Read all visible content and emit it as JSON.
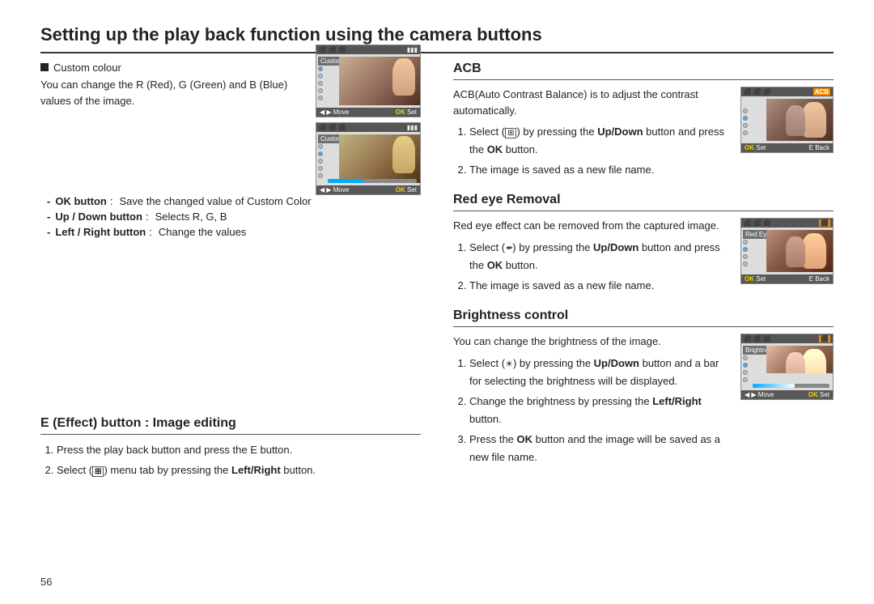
{
  "page": {
    "title": "Setting up the play back function using the camera buttons",
    "number": "56"
  },
  "left_col": {
    "custom_colour": {
      "heading": "Custom colour",
      "description": "You can change the R (Red), G (Green) and B (Blue) values of the image.",
      "details": [
        {
          "label": "OK button",
          "colon": ":",
          "value": "Save the changed value of Custom Color"
        },
        {
          "label": "Up / Down button",
          "colon": ":",
          "value": "Selects R, G, B"
        },
        {
          "label": "Left / Right button",
          "colon": ":",
          "value": "Change the values"
        }
      ],
      "screen1_label": "Custom Color",
      "screen1_bottom_left": "Move",
      "screen1_bottom_right": "Set",
      "screen2_label": "Custom Color",
      "screen2_bottom_left": "Move",
      "screen2_bottom_right": "Set"
    },
    "e_effect": {
      "heading": "E (Effect) button : Image editing",
      "steps": [
        "Press the play back button and press the E button.",
        "Select (      ) menu tab by pressing the Left/Right button."
      ],
      "step2_select": "Select",
      "step2_suffix": "menu tab by pressing the"
    }
  },
  "right_col": {
    "acb": {
      "heading": "ACB",
      "description": "ACB(Auto Contrast Balance) is to adjust the contrast automatically.",
      "steps": [
        {
          "text": "Select (",
          "icon": "grid-icon",
          "text2": ") by pressing the",
          "bold": "Up/Down",
          "text3": "button and press the",
          "bold2": "OK",
          "text4": "button."
        },
        {
          "text": "The image is saved as a new file name."
        }
      ],
      "screen_label": "ACB",
      "screen_bottom_left": "Set",
      "screen_bottom_ok": "OK",
      "screen_bottom_e": "E",
      "screen_bottom_back": "Back"
    },
    "red_eye": {
      "heading": "Red eye Removal",
      "description": "Red eye effect can be removed from the captured image.",
      "steps": [
        {
          "text": "Select (",
          "icon": "redeye-icon",
          "text2": ") by pressing the",
          "bold": "Up/Down",
          "text3": "button and press the",
          "bold2": "OK",
          "text4": "button."
        },
        {
          "text": "The image is saved as a new file name."
        }
      ],
      "screen_label": "Red Eye Fix",
      "screen_bottom_left": "Set",
      "screen_bottom_ok": "OK",
      "screen_bottom_e": "E",
      "screen_bottom_back": "Back"
    },
    "brightness": {
      "heading": "Brightness control",
      "description": "You can change the brightness of the image.",
      "steps": [
        {
          "text": "Select (",
          "icon": "sun-icon",
          "text2": ") by pressing the",
          "bold": "Up/Down",
          "text3": "button and a bar for selecting the brightness will be displayed."
        },
        {
          "text": "Change the brightness by pressing the",
          "bold": "Left/Right",
          "text2": "button."
        },
        {
          "text": "Press the",
          "bold": "OK",
          "text2": "button and the image will be saved as a new file name."
        }
      ],
      "screen_label": "Brightness",
      "screen_bottom_left": "Move",
      "screen_bottom_ok": "OK",
      "screen_bottom_set": "Set"
    }
  }
}
